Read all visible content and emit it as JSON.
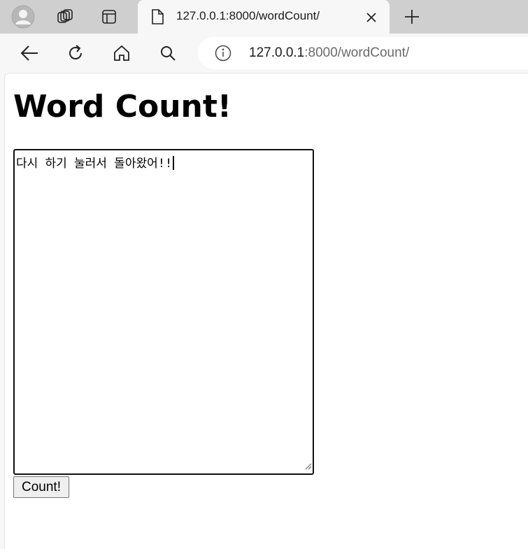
{
  "browser": {
    "tab": {
      "title": "127.0.0.1:8000/wordCount/"
    },
    "address": {
      "host": "127.0.0.1",
      "rest": ":8000/wordCount/"
    }
  },
  "page": {
    "heading": "Word Count!",
    "textarea": {
      "value": "다시 하기 눌러서 돌아왔어!!"
    },
    "count_button": "Count!"
  },
  "icons": {
    "profile": "profile-avatar-icon",
    "workspaces": "workspaces-icon",
    "tab_actions": "tab-actions-icon",
    "favicon": "document-icon",
    "close": "close-icon",
    "new_tab": "plus-icon",
    "back": "back-arrow-icon",
    "refresh": "refresh-icon",
    "home": "home-icon",
    "search": "search-icon",
    "site_info": "info-icon"
  }
}
